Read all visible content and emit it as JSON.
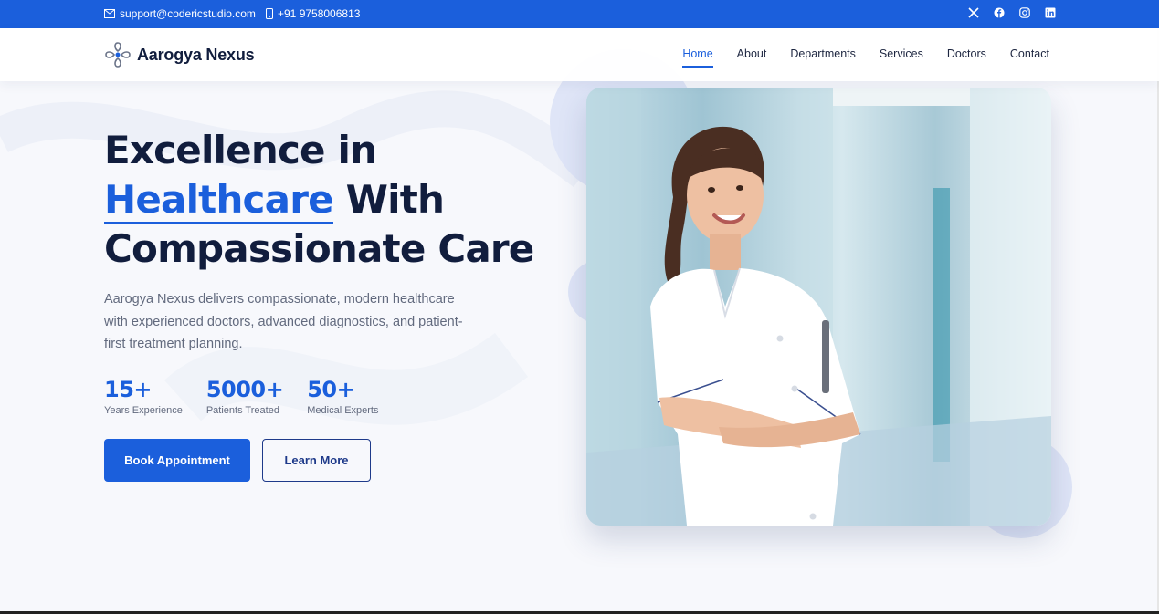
{
  "topbar": {
    "email": "support@codericstudio.com",
    "phone": "+91 9758006813",
    "socials": [
      "x-icon",
      "facebook-icon",
      "instagram-icon",
      "linkedin-icon"
    ]
  },
  "brand": {
    "name": "Aarogya Nexus"
  },
  "nav": {
    "home": "Home",
    "about": "About",
    "departments": "Departments",
    "services": "Services",
    "doctors": "Doctors",
    "contact": "Contact",
    "active": "Home"
  },
  "hero": {
    "title_line1": "Excellence in",
    "title_highlight": "Healthcare",
    "title_line2_rest": "With",
    "title_line3": "Compassionate Care",
    "description": "Aarogya Nexus delivers compassionate, modern healthcare with experienced doctors, advanced diagnostics, and patient-first treatment planning.",
    "stats": [
      {
        "value": "15+",
        "label": "Years Experience"
      },
      {
        "value": "5000+",
        "label": "Patients Treated"
      },
      {
        "value": "50+",
        "label": "Medical Experts"
      }
    ],
    "primary_button": "Book Appointment",
    "secondary_button": "Learn More"
  },
  "colors": {
    "accent": "#1b5fdc",
    "heading": "#111d3d",
    "body_text": "#626a7e"
  }
}
